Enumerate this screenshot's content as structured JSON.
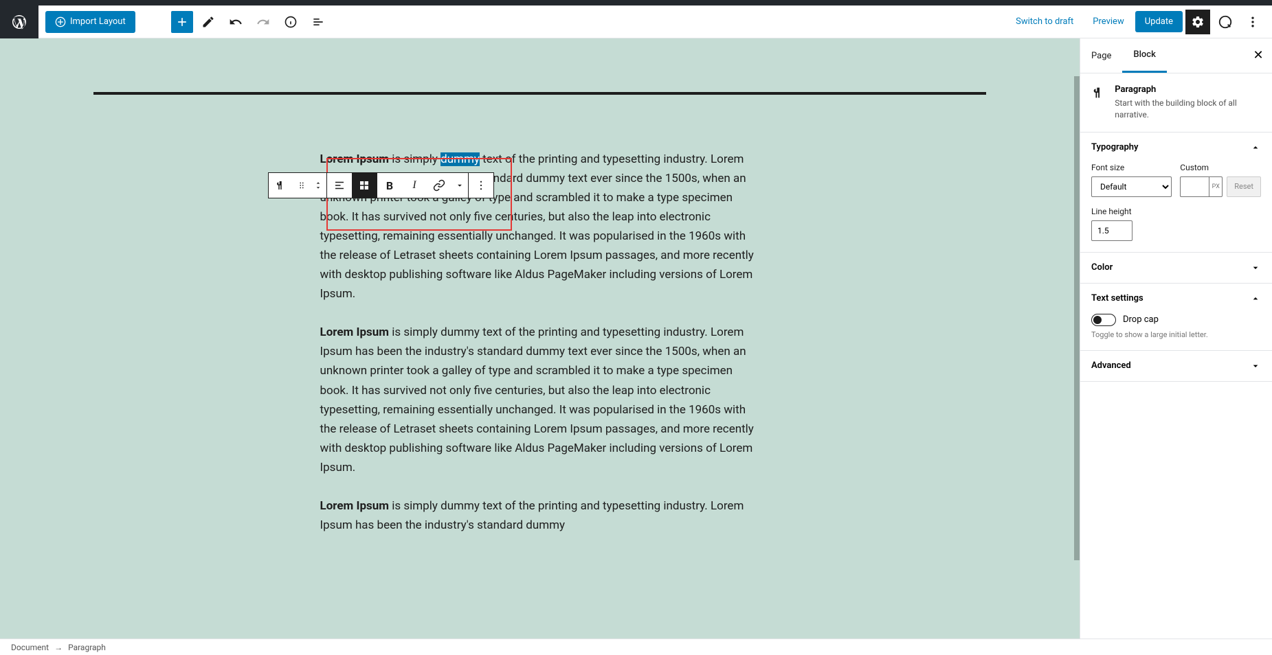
{
  "header": {
    "import_label": "Import Layout",
    "switch_draft": "Switch to draft",
    "preview": "Preview",
    "update": "Update"
  },
  "content": {
    "p1_bold": "Lorem Ipsum",
    "p1_a": " is simply ",
    "p1_highlight": "dummy",
    "p1_b": " text of the printing and typesetting industry. Lorem Ipsum has been the industry's standard dummy text ever since the 1500s, when an unknown printer took a galley of type and scrambled it to make a type specimen book. It has survived not only five centuries, but also the leap into electronic typesetting, remaining essentially unchanged. It was popularised in the 1960s with the release of Letraset sheets containing Lorem Ipsum passages, and more recently with desktop publishing software like Aldus PageMaker including versions of Lorem Ipsum.",
    "p2_bold": "Lorem Ipsum",
    "p2": " is simply dummy text of the printing and typesetting industry. Lorem Ipsum has been the industry's standard dummy text ever since the 1500s, when an unknown printer took a galley of type and scrambled it to make a type specimen book. It has survived not only five centuries, but also the leap into electronic typesetting, remaining essentially unchanged. It was popularised in the 1960s with the release of Letraset sheets containing Lorem Ipsum passages, and more recently with desktop publishing software like Aldus PageMaker including versions of Lorem Ipsum.",
    "p3_bold": "Lorem Ipsum",
    "p3": " is simply dummy text of the printing and typesetting industry. Lorem Ipsum has been the industry's standard dummy"
  },
  "sidebar": {
    "tabs": {
      "page": "Page",
      "block": "Block"
    },
    "block_header": {
      "title": "Paragraph",
      "desc": "Start with the building block of all narrative."
    },
    "typography": {
      "title": "Typography",
      "font_size_label": "Font size",
      "font_size_value": "Default",
      "custom_label": "Custom",
      "custom_unit": "PX",
      "reset": "Reset",
      "line_height_label": "Line height",
      "line_height_value": "1.5"
    },
    "color": {
      "title": "Color"
    },
    "text_settings": {
      "title": "Text settings",
      "drop_cap": "Drop cap",
      "help": "Toggle to show a large initial letter."
    },
    "advanced": {
      "title": "Advanced"
    }
  },
  "footer": {
    "document": "Document",
    "arrow": "→",
    "paragraph": "Paragraph"
  }
}
